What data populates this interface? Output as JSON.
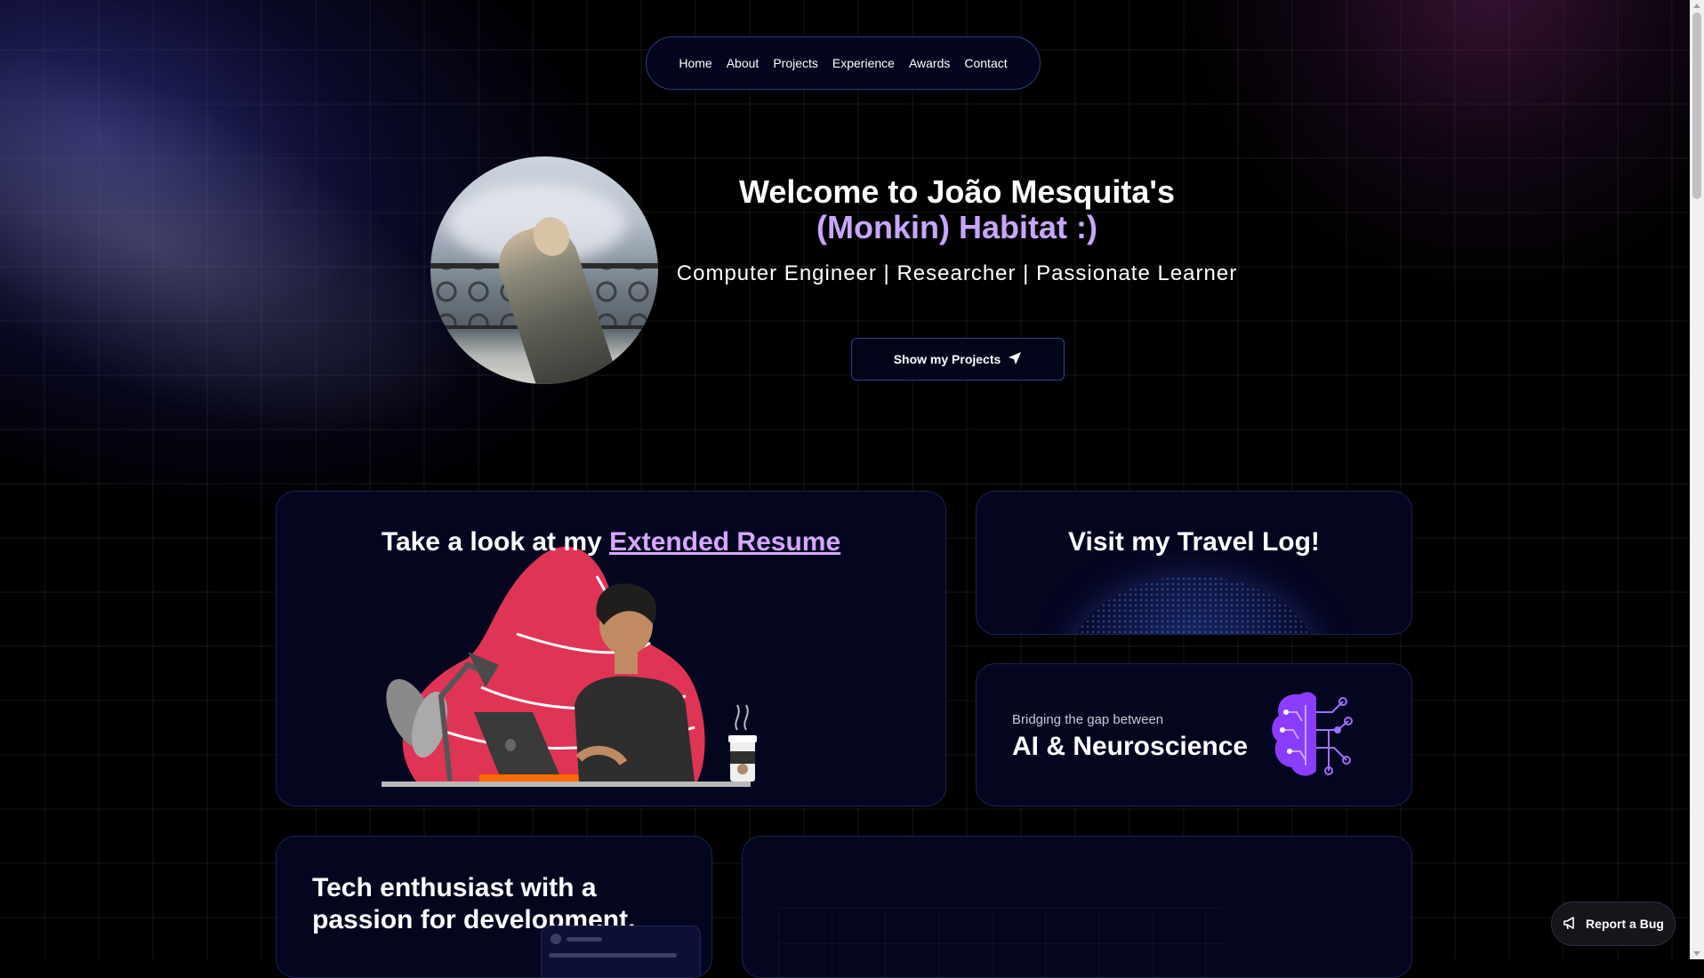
{
  "nav": {
    "items": [
      "Home",
      "About",
      "Projects",
      "Experience",
      "Awards",
      "Contact"
    ]
  },
  "hero": {
    "title_line1": "Welcome to João Mesquita's",
    "title_line2": "(Monkin) Habitat :)",
    "subtitle": "Computer Engineer | Researcher | Passionate Learner",
    "cta_label": "Show my Projects"
  },
  "cards": {
    "resume": {
      "prefix": "Take a look at my ",
      "link": "Extended Resume"
    },
    "travel": {
      "title": "Visit my Travel Log!"
    },
    "ai": {
      "small": "Bridging the gap between",
      "big": "AI & Neuroscience"
    },
    "tech": {
      "line1": "Tech enthusiast with a",
      "line2": "passion for development."
    }
  },
  "report_bug": {
    "label": "Report a Bug"
  },
  "colors": {
    "accent": "#c8a6ff",
    "link": "#d7a7ff",
    "card_bg": "#04051f",
    "border": "#1c2358",
    "illustration_blob": "#e03454",
    "brain": "#8a3cff"
  }
}
